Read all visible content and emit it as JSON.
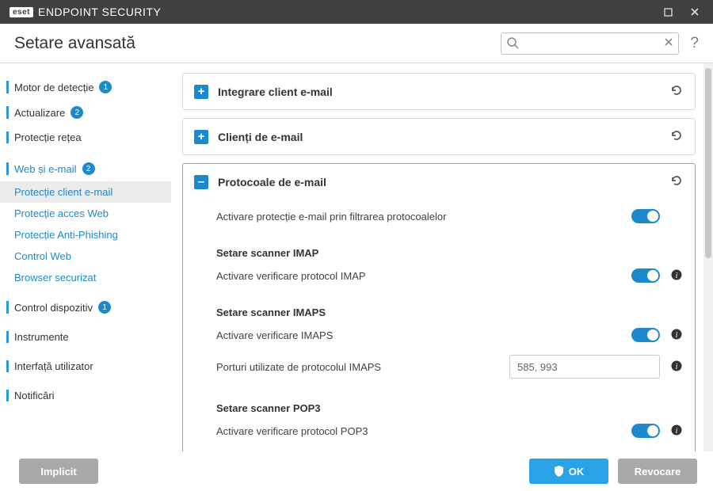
{
  "window": {
    "brand_badge": "eset",
    "brand_text": "ENDPOINT SECURITY"
  },
  "header": {
    "title": "Setare avansată",
    "search_placeholder": ""
  },
  "sidebar": {
    "items": [
      {
        "label": "Motor de detecție",
        "badge": "1",
        "kind": "top"
      },
      {
        "label": "Actualizare",
        "badge": "2",
        "kind": "top"
      },
      {
        "label": "Protecție rețea",
        "badge": "",
        "kind": "top"
      },
      {
        "label": "Web și e-mail",
        "badge": "2",
        "kind": "top"
      },
      {
        "label": "Protecție client e-mail",
        "kind": "sub",
        "active": true
      },
      {
        "label": "Protecție acces Web",
        "kind": "sub"
      },
      {
        "label": "Protecție Anti-Phishing",
        "kind": "sub"
      },
      {
        "label": "Control Web",
        "kind": "sub"
      },
      {
        "label": "Browser securizat",
        "kind": "sub"
      },
      {
        "label": "Control dispozitiv",
        "badge": "1",
        "kind": "top"
      },
      {
        "label": "Instrumente",
        "badge": "",
        "kind": "top"
      },
      {
        "label": "Interfață utilizator",
        "badge": "",
        "kind": "top"
      },
      {
        "label": "Notificări",
        "badge": "",
        "kind": "top"
      }
    ]
  },
  "accordions": {
    "a0": {
      "label": "Integrare client e-mail",
      "expanded": false,
      "icon": "+"
    },
    "a1": {
      "label": "Clienți de e-mail",
      "expanded": false,
      "icon": "+"
    },
    "a2": {
      "label": "Protocoale de e-mail",
      "expanded": true,
      "icon": "–"
    }
  },
  "settings": {
    "enable_filter": {
      "label": "Activare protecție e-mail prin filtrarea protocoalelor",
      "value": true
    },
    "imap_head": "Setare scanner IMAP",
    "imap_enable": {
      "label": "Activare verificare protocol IMAP",
      "value": true,
      "info": true
    },
    "imaps_head": "Setare scanner IMAPS",
    "imaps_enable": {
      "label": "Activare verificare IMAPS",
      "value": true,
      "info": true
    },
    "imaps_ports": {
      "label": "Porturi utilizate de protocolul IMAPS",
      "value": "585, 993",
      "info": true
    },
    "pop3_head": "Setare scanner POP3",
    "pop3_enable": {
      "label": "Activare verificare protocol POP3",
      "value": true,
      "info": true
    }
  },
  "footer": {
    "default": "Implicit",
    "ok": "OK",
    "cancel": "Revocare"
  }
}
